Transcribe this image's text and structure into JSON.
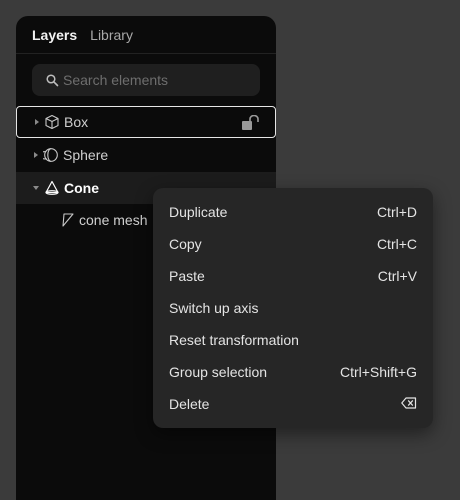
{
  "tabs": [
    {
      "label": "Layers"
    },
    {
      "label": "Library"
    }
  ],
  "search": {
    "placeholder": "Search elements",
    "value": ""
  },
  "layers": [
    {
      "label": "Box",
      "icon": "cube-icon",
      "expanded": false,
      "locked": true,
      "state": "hovered"
    },
    {
      "label": "Sphere",
      "icon": "sphere-icon",
      "expanded": false
    },
    {
      "label": "Cone",
      "icon": "cone-icon",
      "expanded": true,
      "state": "selected",
      "children": [
        {
          "label": "cone mesh",
          "icon": "mesh-icon"
        }
      ]
    }
  ],
  "context_menu": {
    "items": [
      {
        "label": "Duplicate",
        "shortcut": "Ctrl+D"
      },
      {
        "label": "Copy",
        "shortcut": "Ctrl+C"
      },
      {
        "label": "Paste",
        "shortcut": "Ctrl+V"
      },
      {
        "label": "Switch up axis",
        "shortcut": ""
      },
      {
        "label": "Reset transformation",
        "shortcut": ""
      },
      {
        "label": "Group selection",
        "shortcut": "Ctrl+Shift+G"
      },
      {
        "label": "Delete",
        "shortcut_icon": "backspace-icon"
      }
    ]
  },
  "colors": {
    "canvas": "#3b3b3b",
    "panel": "#0b0b0b",
    "menu": "#262626"
  }
}
